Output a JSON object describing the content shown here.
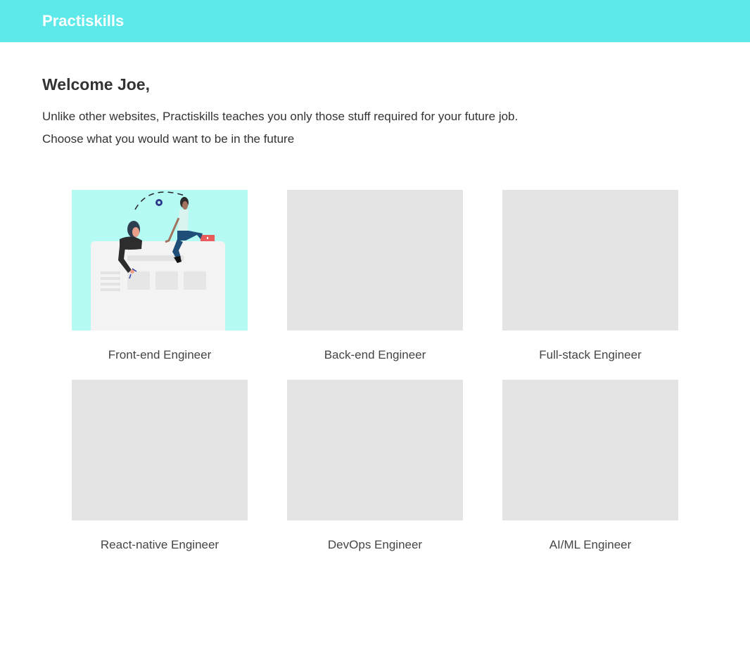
{
  "header": {
    "brand": "Practiskills",
    "bar_color": "#5de8e9"
  },
  "welcome": {
    "title": "Welcome Joe,",
    "line1": "Unlike other websites, Practiskills teaches you only those stuff required for your future job.",
    "line2": "Choose what you would want to be in the future"
  },
  "careers": [
    {
      "label": "Front-end Engineer",
      "image": "team-building-website-illustration"
    },
    {
      "label": "Back-end Engineer",
      "image": "placeholder"
    },
    {
      "label": "Full-stack Engineer",
      "image": "placeholder"
    },
    {
      "label": "React-native Engineer",
      "image": "placeholder"
    },
    {
      "label": "DevOps Engineer",
      "image": "placeholder"
    },
    {
      "label": "AI/ML Engineer",
      "image": "placeholder"
    }
  ]
}
